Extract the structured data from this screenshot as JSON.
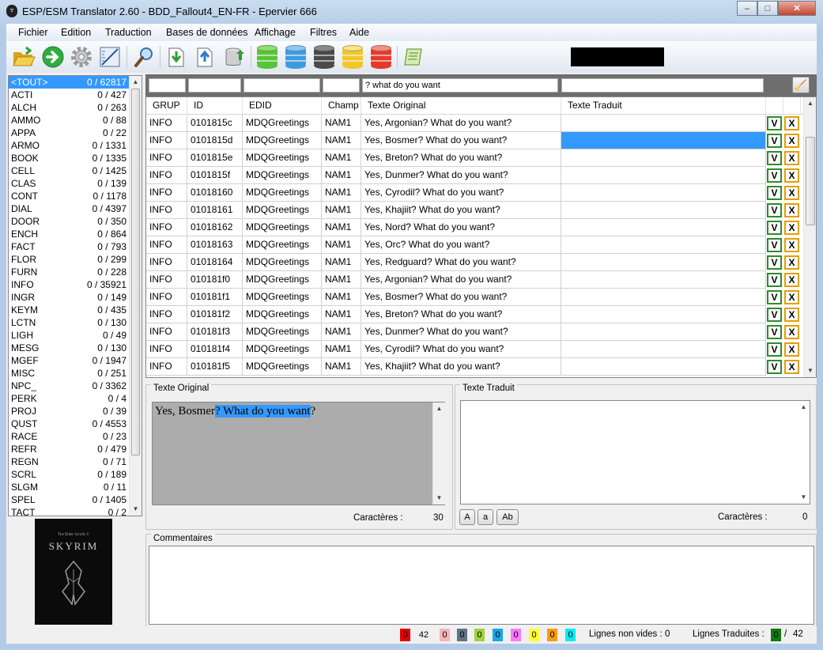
{
  "window": {
    "title": "ESP/ESM Translator 2.60 - BDD_Fallout4_EN-FR - Epervier 666",
    "icon": "skyrim-dragon-icon",
    "minimize": "‒",
    "maximize": "□",
    "close": "✕"
  },
  "menu": [
    "Fichier",
    "Edition",
    "Traduction",
    "Bases de données",
    "Affichage",
    "Filtres",
    "Aide"
  ],
  "toolbar": {
    "buttons": [
      "open-folder-icon",
      "go-arrow-icon",
      "gear-icon",
      "ruler-icon",
      "search-icon",
      "import-icon",
      "export-icon",
      "database-export-icon"
    ],
    "databases": [
      {
        "name": "green-database-icon",
        "color": "#58c43a"
      },
      {
        "name": "blue-database-icon",
        "color": "#3f9be0"
      },
      {
        "name": "black-database-icon",
        "color": "#4a4a4a"
      },
      {
        "name": "yellow-database-icon",
        "color": "#f3c62a"
      },
      {
        "name": "red-database-icon",
        "color": "#e53a2a"
      }
    ],
    "extra": "scroll-icon"
  },
  "record_types": [
    {
      "name": "<TOUT>",
      "count": "0 / 62817"
    },
    {
      "name": "ACTI",
      "count": "0 / 427"
    },
    {
      "name": "ALCH",
      "count": "0 / 263"
    },
    {
      "name": "AMMO",
      "count": "0 / 88"
    },
    {
      "name": "APPA",
      "count": "0 / 22"
    },
    {
      "name": "ARMO",
      "count": "0 / 1331"
    },
    {
      "name": "BOOK",
      "count": "0 / 1335"
    },
    {
      "name": "CELL",
      "count": "0 / 1425"
    },
    {
      "name": "CLAS",
      "count": "0 / 139"
    },
    {
      "name": "CONT",
      "count": "0 / 1178"
    },
    {
      "name": "DIAL",
      "count": "0 / 4397"
    },
    {
      "name": "DOOR",
      "count": "0 / 350"
    },
    {
      "name": "ENCH",
      "count": "0 / 864"
    },
    {
      "name": "FACT",
      "count": "0 / 793"
    },
    {
      "name": "FLOR",
      "count": "0 / 299"
    },
    {
      "name": "FURN",
      "count": "0 / 228"
    },
    {
      "name": "INFO",
      "count": "0 / 35921"
    },
    {
      "name": "INGR",
      "count": "0 / 149"
    },
    {
      "name": "KEYM",
      "count": "0 / 435"
    },
    {
      "name": "LCTN",
      "count": "0 / 130"
    },
    {
      "name": "LIGH",
      "count": "0 / 49"
    },
    {
      "name": "MESG",
      "count": "0 / 130"
    },
    {
      "name": "MGEF",
      "count": "0 / 1947"
    },
    {
      "name": "MISC",
      "count": "0 / 251"
    },
    {
      "name": "NPC_",
      "count": "0 / 3362"
    },
    {
      "name": "PERK",
      "count": "0 / 4"
    },
    {
      "name": "PROJ",
      "count": "0 / 39"
    },
    {
      "name": "QUST",
      "count": "0 / 4553"
    },
    {
      "name": "RACE",
      "count": "0 / 23"
    },
    {
      "name": "REFR",
      "count": "0 / 479"
    },
    {
      "name": "REGN",
      "count": "0 / 71"
    },
    {
      "name": "SCRL",
      "count": "0 / 189"
    },
    {
      "name": "SLGM",
      "count": "0 / 11"
    },
    {
      "name": "SPEL",
      "count": "0 / 1405"
    },
    {
      "name": "TACT",
      "count": "0 / 2"
    }
  ],
  "cover": {
    "subtitle": "The Elder Scrolls V",
    "title": "SKYRIM"
  },
  "filters": {
    "grup": "",
    "id": "",
    "edid": "",
    "champ": "",
    "original": "? what do you want",
    "traduit": ""
  },
  "grid": {
    "columns": [
      "GRUP",
      "ID",
      "EDID",
      "Champ",
      "Texte Original",
      "Texte Traduit"
    ],
    "validate_label": "V",
    "reject_label": "X",
    "rows": [
      [
        "INFO",
        "0101815c",
        "MDQGreetings",
        "NAM1",
        "Yes, Argonian? What do you want?",
        ""
      ],
      [
        "INFO",
        "0101815d",
        "MDQGreetings",
        "NAM1",
        "Yes, Bosmer? What do you want?",
        ""
      ],
      [
        "INFO",
        "0101815e",
        "MDQGreetings",
        "NAM1",
        "Yes, Breton? What do you want?",
        ""
      ],
      [
        "INFO",
        "0101815f",
        "MDQGreetings",
        "NAM1",
        "Yes, Dunmer? What do you want?",
        ""
      ],
      [
        "INFO",
        "01018160",
        "MDQGreetings",
        "NAM1",
        "Yes, Cyrodil? What do you want?",
        ""
      ],
      [
        "INFO",
        "01018161",
        "MDQGreetings",
        "NAM1",
        "Yes, Khajiit? What do you want?",
        ""
      ],
      [
        "INFO",
        "01018162",
        "MDQGreetings",
        "NAM1",
        "Yes, Nord? What do you want?",
        ""
      ],
      [
        "INFO",
        "01018163",
        "MDQGreetings",
        "NAM1",
        "Yes, Orc? What do you want?",
        ""
      ],
      [
        "INFO",
        "01018164",
        "MDQGreetings",
        "NAM1",
        "Yes, Redguard? What do you want?",
        ""
      ],
      [
        "INFO",
        "010181f0",
        "MDQGreetings",
        "NAM1",
        "Yes, Argonian? What do you want?",
        ""
      ],
      [
        "INFO",
        "010181f1",
        "MDQGreetings",
        "NAM1",
        "Yes, Bosmer? What do you want?",
        ""
      ],
      [
        "INFO",
        "010181f2",
        "MDQGreetings",
        "NAM1",
        "Yes, Breton? What do you want?",
        ""
      ],
      [
        "INFO",
        "010181f3",
        "MDQGreetings",
        "NAM1",
        "Yes, Dunmer? What do you want?",
        ""
      ],
      [
        "INFO",
        "010181f4",
        "MDQGreetings",
        "NAM1",
        "Yes, Cyrodil? What do you want?",
        ""
      ],
      [
        "INFO",
        "010181f5",
        "MDQGreetings",
        "NAM1",
        "Yes, Khajiit? What do you want?",
        ""
      ]
    ]
  },
  "original_panel": {
    "label": "Texte Original",
    "text_before": "Yes, Bosmer",
    "text_selected": "? What do you want",
    "text_after": "?",
    "chars_label": "Caractères :",
    "chars_value": "30"
  },
  "translated_panel": {
    "label": "Texte Traduit",
    "text": "",
    "case_buttons": [
      "A",
      "a",
      "Ab"
    ],
    "chars_label": "Caractères :",
    "chars_value": "0"
  },
  "comments": {
    "label": "Commentaires",
    "text": ""
  },
  "statusbar": {
    "swatches": [
      {
        "value": "0",
        "color": "#e00000",
        "fg": "#000"
      },
      {
        "value": "42",
        "color": "#ffffff",
        "fg": "#000"
      },
      {
        "value": "0",
        "color": "#f6b6b6",
        "fg": "#000"
      },
      {
        "value": "0",
        "color": "#5f7386",
        "fg": "#000"
      },
      {
        "value": "0",
        "color": "#9fd23f",
        "fg": "#000"
      },
      {
        "value": "0",
        "color": "#17a7ec",
        "fg": "#000"
      },
      {
        "value": "0",
        "color": "#ff77ff",
        "fg": "#000"
      },
      {
        "value": "0",
        "color": "#ffff30",
        "fg": "#000"
      },
      {
        "value": "0",
        "color": "#ff9a10",
        "fg": "#000"
      },
      {
        "value": "0",
        "color": "#00ecf4",
        "fg": "#000"
      }
    ],
    "non_empty_label": "Lignes non vides :",
    "non_empty_value": "0",
    "translated_label": "Lignes Traduites :",
    "translated_value": "0",
    "total_separator": "/",
    "total_value": "42"
  }
}
